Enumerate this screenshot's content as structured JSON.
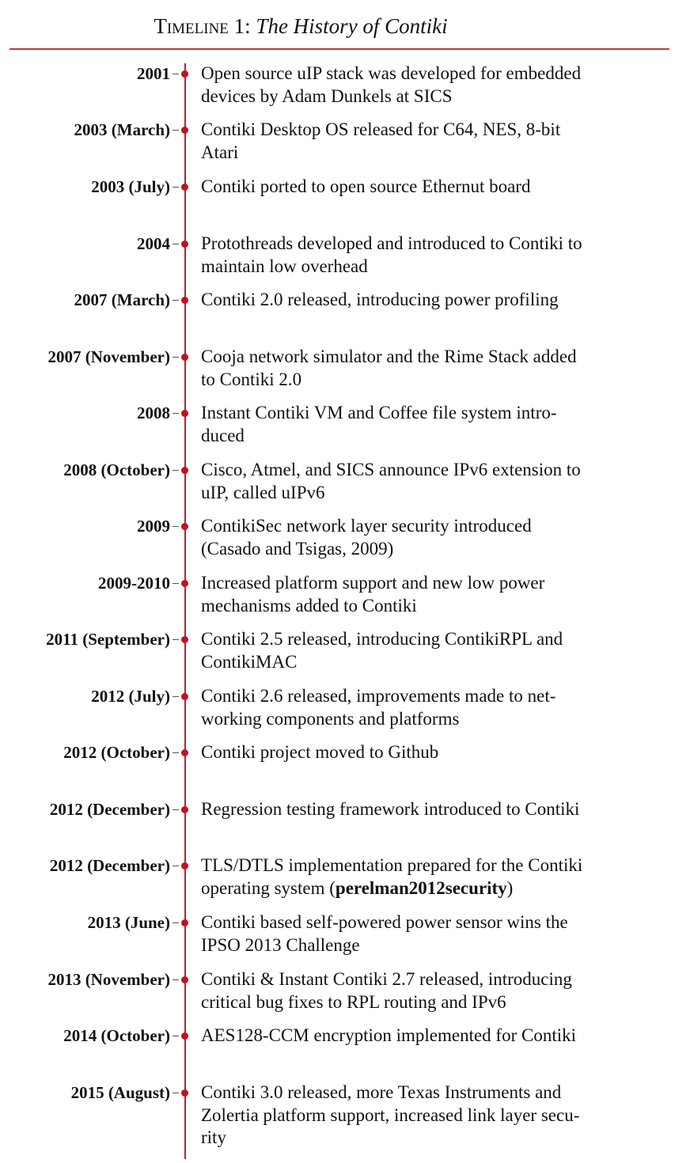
{
  "title": {
    "label": "Timeline 1:",
    "italic": "The History of Contiki"
  },
  "events": [
    {
      "date": "2001",
      "text": "Open source uIP stack was developed for embedded\ndevices by Adam Dunkels at SICS"
    },
    {
      "date": "2003 (March)",
      "text": "Contiki Desktop OS released for C64, NES, 8-bit\nAtari"
    },
    {
      "date": "2003 (July)",
      "text": "Contiki ported to open source Ethernut board"
    },
    {
      "date": "2004",
      "text": "Protothreads developed and introduced to Contiki to\nmaintain low overhead"
    },
    {
      "date": "2007 (March)",
      "text": "Contiki 2.0 released, introducing power profiling"
    },
    {
      "date": "2007 (November)",
      "text": "Cooja network simulator and the Rime Stack added\nto Contiki 2.0"
    },
    {
      "date": "2008",
      "text": "Instant Contiki VM and Coffee file system intro-\nduced"
    },
    {
      "date": "2008 (October)",
      "text": "Cisco, Atmel, and SICS announce IPv6 extension to\nuIP, called uIPv6"
    },
    {
      "date": "2009",
      "text": "ContikiSec network layer security introduced\n(Casado and Tsigas, 2009)"
    },
    {
      "date": "2009-2010",
      "text": "Increased platform support and new low power\nmechanisms added to Contiki"
    },
    {
      "date": "2011 (September)",
      "text": "Contiki 2.5 released, introducing ContikiRPL and\nContikiMAC"
    },
    {
      "date": "2012 (July)",
      "text": "Contiki 2.6 released, improvements made to net-\nworking components and platforms"
    },
    {
      "date": "2012 (October)",
      "text": "Contiki project moved to Github"
    },
    {
      "date": "2012 (December)",
      "text": "Regression testing framework introduced to Contiki"
    },
    {
      "date": "2012 (December)",
      "text": "TLS/DTLS implementation prepared for the Contiki\noperating system (",
      "bold": "perelman2012security",
      "after": ")"
    },
    {
      "date": "2013 (June)",
      "text": "Contiki based self-powered power sensor wins the\nIPSO 2013 Challenge"
    },
    {
      "date": "2013 (November)",
      "text": "Contiki & Instant Contiki 2.7 released, introducing\ncritical bug fixes to RPL routing and IPv6"
    },
    {
      "date": "2014 (October)",
      "text": "AES128-CCM encryption implemented for Contiki"
    },
    {
      "date": "2015 (August)",
      "text": "Contiki 3.0 released, more Texas Instruments and\nZolertia platform support, increased link layer secu-\nrity"
    }
  ]
}
